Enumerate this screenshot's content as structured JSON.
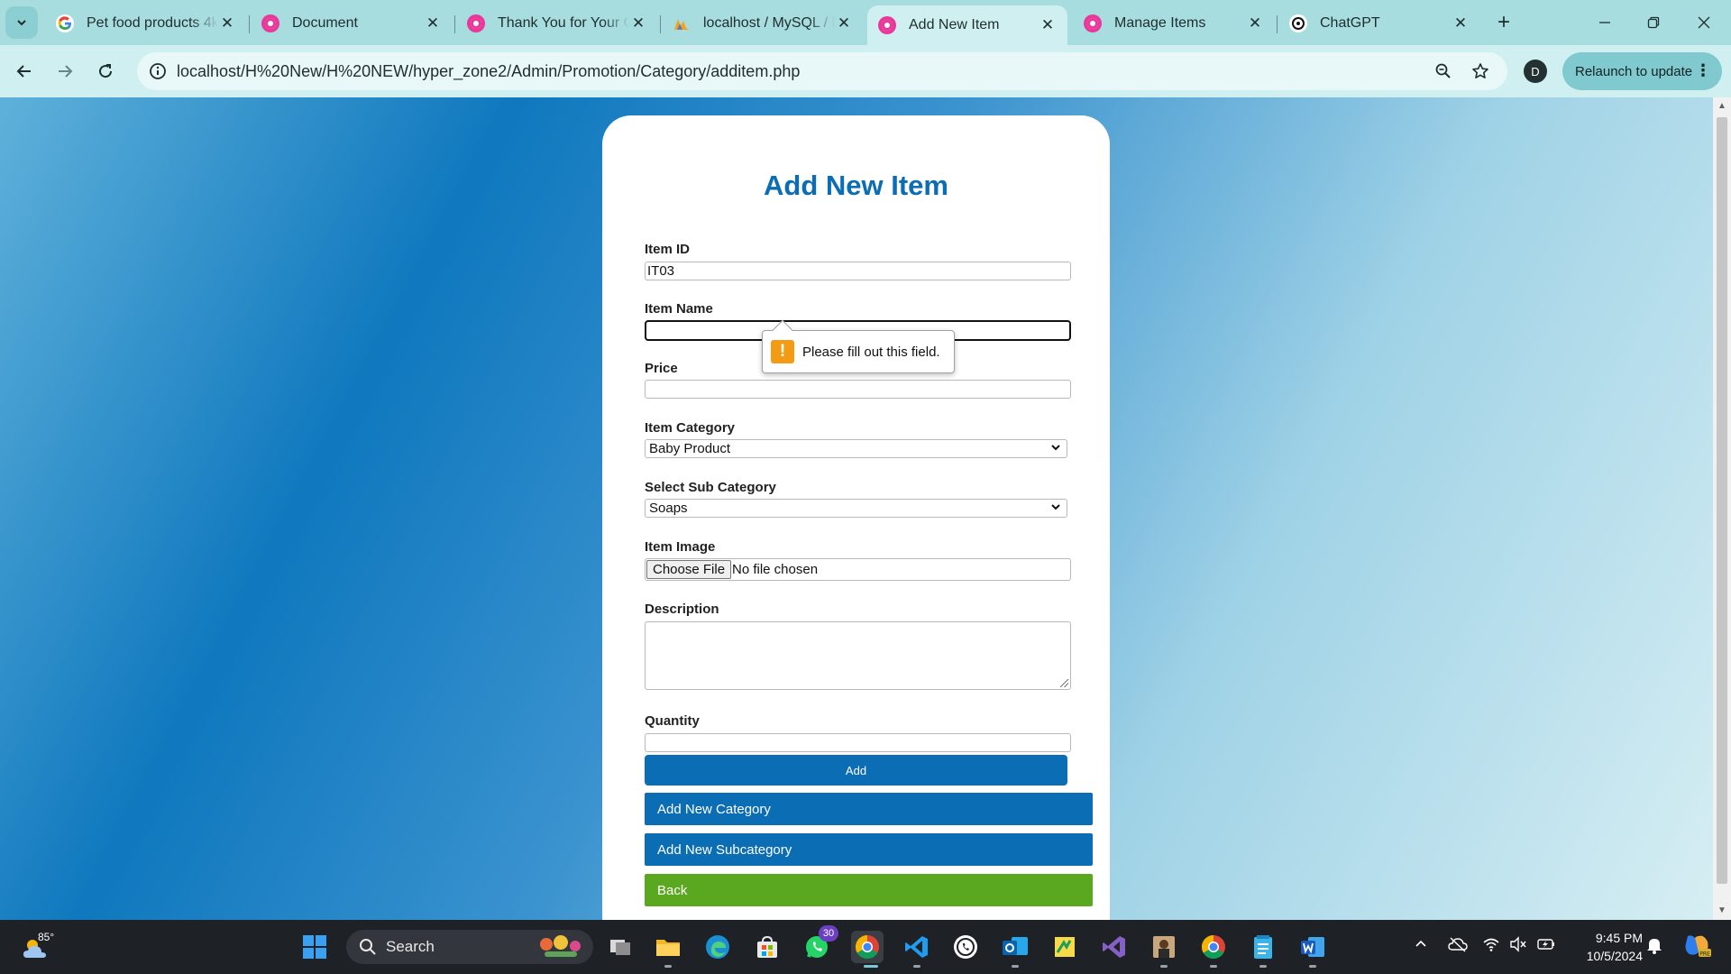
{
  "browser": {
    "tabs": [
      {
        "title": "Pet food products 4k",
        "favicon": "google-icon"
      },
      {
        "title": "Document",
        "favicon": "wamp-icon"
      },
      {
        "title": "Thank You for Your C",
        "favicon": "wamp-icon"
      },
      {
        "title": "localhost / MySQL / l",
        "favicon": "phpmyadmin-icon"
      },
      {
        "title": "Add New Item",
        "favicon": "wamp-icon",
        "active": true
      },
      {
        "title": "Manage Items",
        "favicon": "wamp-icon"
      },
      {
        "title": "ChatGPT",
        "favicon": "chatgpt-icon"
      }
    ],
    "url": "localhost/H%20New/H%20NEW/hyper_zone2/Admin/Promotion/Category/additem.php",
    "profile_initial": "D",
    "relaunch_label": "Relaunch to update"
  },
  "form": {
    "title": "Add New Item",
    "item_id_label": "Item ID",
    "item_id_value": "IT03",
    "item_name_label": "Item Name",
    "item_name_value": "",
    "price_label": "Price",
    "price_value": "",
    "category_label": "Item Category",
    "category_value": "Baby Product",
    "subcategory_label": "Select Sub Category",
    "subcategory_value": "Soaps",
    "image_label": "Item Image",
    "file_button": "Choose File",
    "file_status": "No file chosen",
    "description_label": "Description",
    "quantity_label": "Quantity",
    "add_button": "Add",
    "add_category_button": "Add New Category",
    "add_subcategory_button": "Add New Subcategory",
    "back_button": "Back"
  },
  "validation": {
    "message": "Please fill out this field."
  },
  "taskbar": {
    "weather_temp": "85°",
    "search_label": "Search",
    "whatsapp_badge": "30",
    "time": "9:45 PM",
    "date": "10/5/2024"
  },
  "colors": {
    "accent": "#0b6db3",
    "back_button": "#5aa81f",
    "warning": "#f39b13"
  }
}
